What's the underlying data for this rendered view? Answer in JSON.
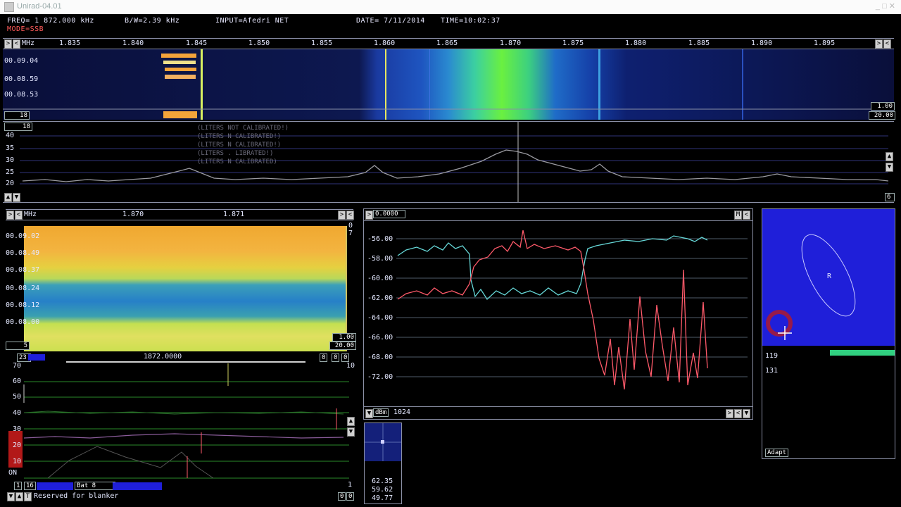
{
  "window": {
    "title": "Unirad-04.01",
    "controls": "_ □ ✕"
  },
  "status": {
    "freq": "FREQ=  1 872.000 kHz",
    "bw": "B/W=2.39 kHz",
    "input": "INPUT=Afedri NET",
    "date": "DATE=  7/11/2014",
    "time": "TIME=10:02:37",
    "mode": "MODE=SSB"
  },
  "main_scale": {
    "unit": "MHz",
    "ticks": [
      "1.835",
      "1.840",
      "1.845",
      "1.850",
      "1.855",
      "1.860",
      "1.865",
      "1.870",
      "1.875",
      "1.880",
      "1.885",
      "1.890",
      "1.895"
    ]
  },
  "main_waterfall": {
    "times": [
      "00.09.04",
      "00.08.59",
      "00.08.53"
    ],
    "left_value": "18",
    "right_top": "1.00",
    "right_bottom": "20.00"
  },
  "main_spectrum": {
    "ref_box": "18",
    "y_labels": [
      "40",
      "35",
      "30",
      "25",
      "20"
    ],
    "right_box": "6",
    "cal_lines": [
      "(LITERS NOT CALIBRATED!)",
      "(LITERS  N  CALIBRATED!)",
      "(LITERS  N  CALIBRATED!)",
      "(LITERS  .    LIBRATED!)",
      "(LITERS  N  CALIBRATED)"
    ]
  },
  "zoom_panel": {
    "unit": "MHz",
    "ticks": [
      "1.870",
      "1.871"
    ],
    "times": [
      "00.09.02",
      "00.08.49",
      "00.08.37",
      "00.08.24",
      "00.08.12",
      "00.08.00"
    ],
    "right_top_a": "0",
    "right_top_b": "7",
    "left_box": "5",
    "right_box1": "1.00",
    "right_box2": "20.00"
  },
  "narrow_spectrum": {
    "left_box": "23",
    "center_freq": "1872.0000",
    "right_boxes": [
      "0",
      "0",
      "0"
    ],
    "right_top": "10",
    "y_labels": [
      "70",
      "60",
      "50",
      "40",
      "30",
      "20",
      "10"
    ],
    "on_label": "ON",
    "right_bottom": "1",
    "bottom_left": "1",
    "bottom_16": "16",
    "bat": "Bat  8",
    "blanker_text": "Reserved for blanker",
    "bottom_right": "0"
  },
  "level_plot": {
    "header_value": "0.0000",
    "header_btn": "M",
    "y_labels": [
      "-56.00",
      "-58.00",
      "-60.00",
      "-62.00",
      "-64.00",
      "-66.00",
      "-68.00",
      "-72.00"
    ],
    "unit": "dBm",
    "samples": "1024",
    "colors": {
      "series_a": "#66d8d8",
      "series_b": "#ff5a6a"
    }
  },
  "small_scope": {
    "readings": [
      "62.35",
      "59.62",
      "49.77"
    ]
  },
  "polar_panel": {
    "label": "R",
    "value1": "119",
    "value2": "131",
    "adapt_label": "Adapt",
    "colors": {
      "background": "#1f1fd9"
    }
  }
}
